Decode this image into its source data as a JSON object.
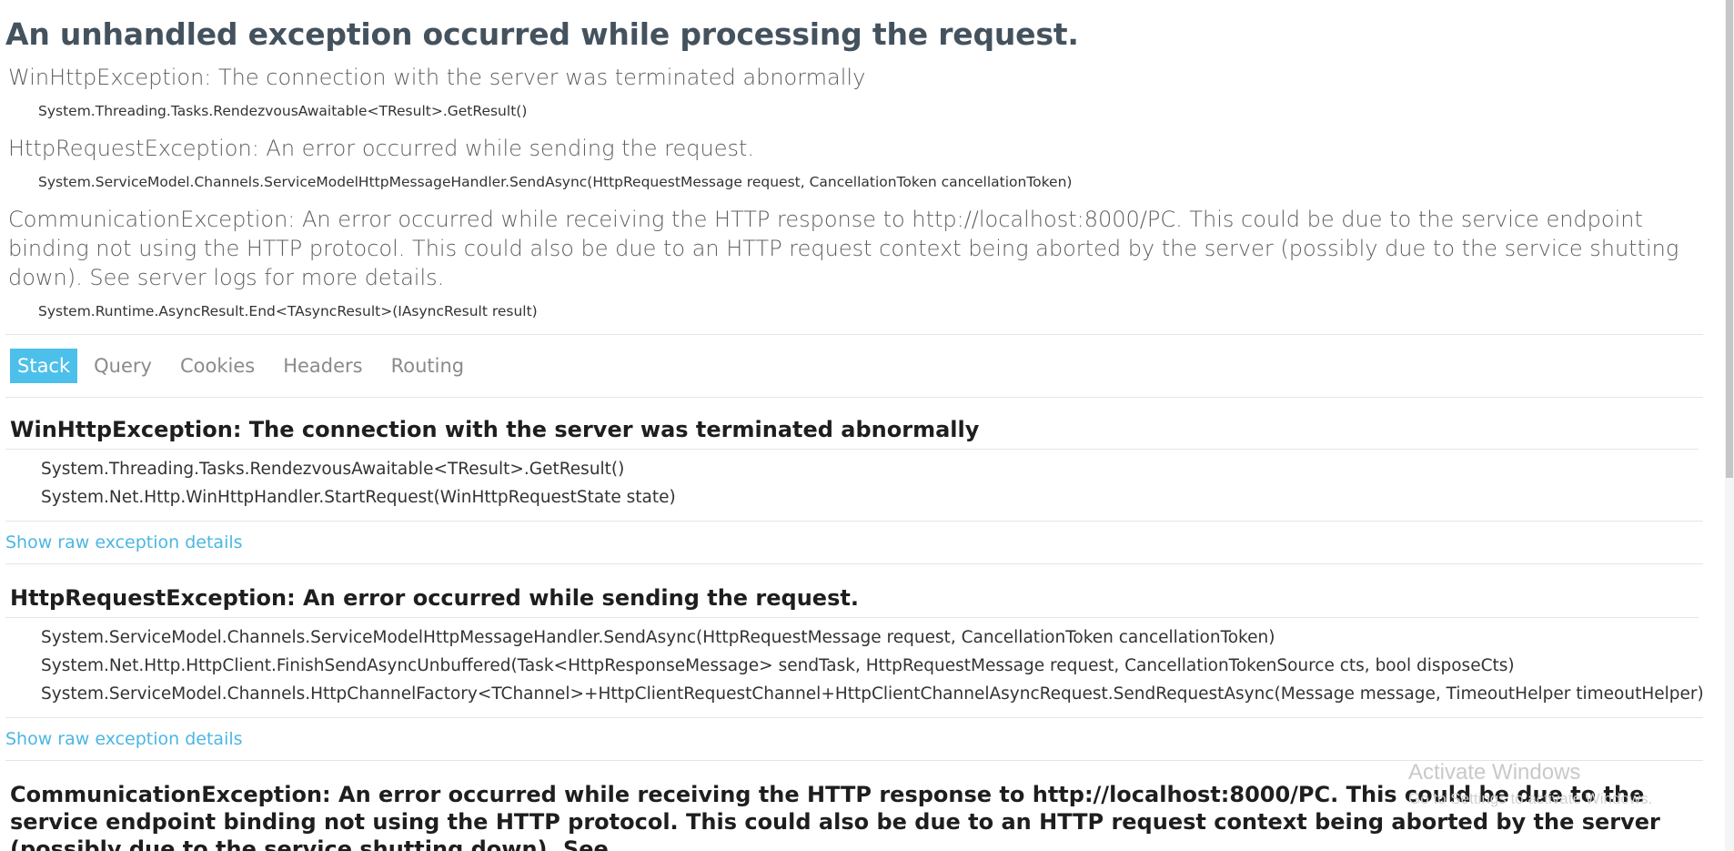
{
  "page": {
    "title": "An unhandled exception occurred while processing the request."
  },
  "summary": [
    {
      "message": "WinHttpException: The connection with the server was terminated abnormally",
      "location": "System.Threading.Tasks.RendezvousAwaitable<TResult>.GetResult()"
    },
    {
      "message": "HttpRequestException: An error occurred while sending the request.",
      "location": "System.ServiceModel.Channels.ServiceModelHttpMessageHandler.SendAsync(HttpRequestMessage request, CancellationToken cancellationToken)"
    },
    {
      "message": "CommunicationException: An error occurred while receiving the HTTP response to http://localhost:8000/PC. This could be due to the service endpoint binding not using the HTTP protocol. This could also be due to an HTTP request context being aborted by the server (possibly due to the service shutting down). See server logs for more details.",
      "location": "System.Runtime.AsyncResult.End<TAsyncResult>(IAsyncResult result)"
    }
  ],
  "tabs": [
    "Stack",
    "Query",
    "Cookies",
    "Headers",
    "Routing"
  ],
  "active_tab": "Stack",
  "stack": [
    {
      "title": "WinHttpException: The connection with the server was terminated abnormally",
      "frames": [
        "System.Threading.Tasks.RendezvousAwaitable<TResult>.GetResult()",
        "System.Net.Http.WinHttpHandler.StartRequest(WinHttpRequestState state)"
      ],
      "raw_link": "Show raw exception details"
    },
    {
      "title": "HttpRequestException: An error occurred while sending the request.",
      "frames": [
        "System.ServiceModel.Channels.ServiceModelHttpMessageHandler.SendAsync(HttpRequestMessage request, CancellationToken cancellationToken)",
        "System.Net.Http.HttpClient.FinishSendAsyncUnbuffered(Task<HttpResponseMessage> sendTask, HttpRequestMessage request, CancellationTokenSource cts, bool disposeCts)",
        "System.ServiceModel.Channels.HttpChannelFactory<TChannel>+HttpClientRequestChannel+HttpClientChannelAsyncRequest.SendRequestAsync(Message message, TimeoutHelper timeoutHelper)"
      ],
      "raw_link": "Show raw exception details"
    },
    {
      "title": "CommunicationException: An error occurred while receiving the HTTP response to http://localhost:8000/PC. This could be due to the service endpoint binding not using the HTTP protocol. This could also be due to an HTTP request context being aborted by the server (possibly due to the service shutting down). See"
    }
  ],
  "watermark": {
    "title": "Activate Windows",
    "subtitle": "Go to Settings to activate Windows."
  },
  "colors": {
    "accent": "#4cc0eb",
    "link": "#4cb6e3",
    "title": "#44525e"
  }
}
